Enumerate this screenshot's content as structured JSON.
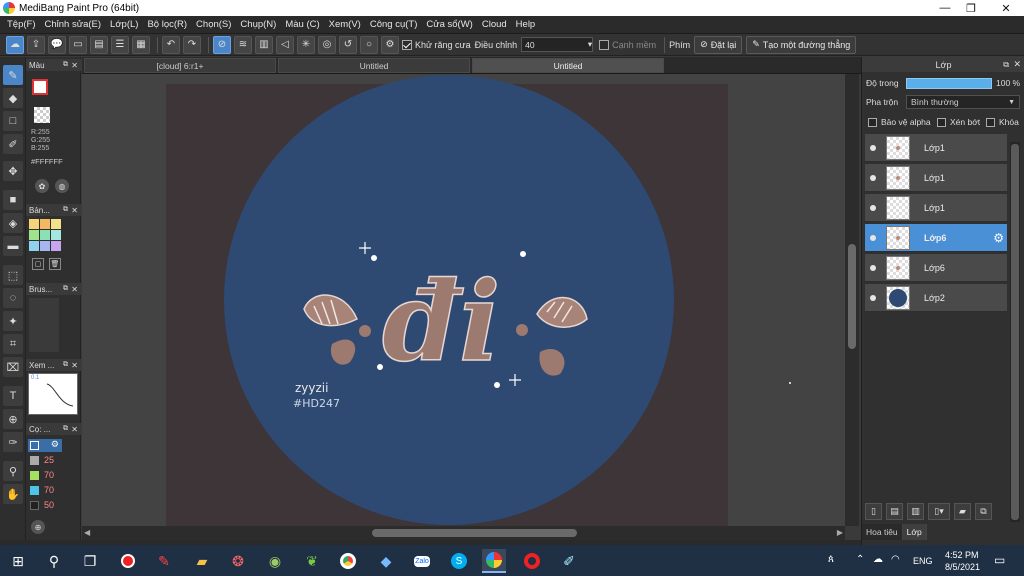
{
  "window": {
    "title": "MediBang Paint Pro (64bit)",
    "minimize": "—",
    "restore": "❐",
    "close": "✕"
  },
  "menu": [
    "Tệp(F)",
    "Chỉnh sửa(E)",
    "Lớp(L)",
    "Bộ lọc(R)",
    "Chọn(S)",
    "Chụp(N)",
    "Màu (C)",
    "Xem(V)",
    "Công cụ(T)",
    "Cửa sổ(W)",
    "Cloud",
    "Help"
  ],
  "toolbar": {
    "antialias_label": "Khử răng cưa",
    "adjust_label": "Điều chỉnh",
    "adjust_value": "40",
    "edge_label": "Cạnh mềm",
    "key_label": "Phím",
    "reset_label": "Đặt lại",
    "line_label": "Tạo một đường thẳng"
  },
  "tabs": [
    "[cloud] 6:r1+",
    "Untitled",
    "Untitled"
  ],
  "left_panels": {
    "color": {
      "title": "Màu",
      "r": "R:255",
      "g": "G:255",
      "b": "B:255",
      "hex": "#FFFFFF"
    },
    "palette": {
      "title": "Bản..."
    },
    "brush": {
      "title": "Brus..."
    },
    "navigator": {
      "title": "Xem ...",
      "zoom": "0.1"
    },
    "brush_size": {
      "title": "Cọ: ...",
      "sizes": [
        "25",
        "70",
        "70",
        "50"
      ]
    }
  },
  "canvas": {
    "text_main": "đi",
    "signature_line1": "zyyzii",
    "signature_line2": "#HD247",
    "background_color": "#2e4a72",
    "ink_color": "#9c7a70"
  },
  "layers_panel": {
    "title": "Lớp",
    "opacity_label": "Độ trong",
    "opacity_value": "100 %",
    "blend_label": "Pha trộn",
    "blend_value": "Bình thường",
    "protect_alpha": "Bảo vệ alpha",
    "clipping": "Xén bớt",
    "lock": "Khóa",
    "layers": [
      "Lớp1",
      "Lớp1",
      "Lớp1",
      "Lớp6",
      "Lớp6",
      "Lớp2"
    ],
    "active_index": 3,
    "bottom_tabs": [
      "Hoa tiêu",
      "Lớp"
    ]
  },
  "taskbar": {
    "lang": "ENG",
    "time": "4:52 PM",
    "date": "8/5/2021",
    "zalo": "Zalo"
  }
}
